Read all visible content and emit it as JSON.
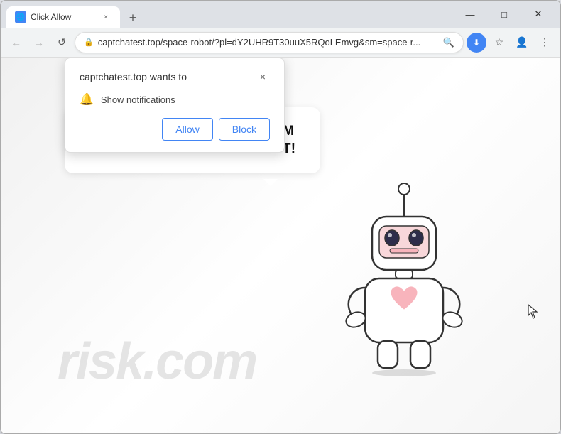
{
  "browser": {
    "title": "Click Allow",
    "tab": {
      "favicon": "🌐",
      "title": "Click Allow",
      "close_label": "×"
    },
    "new_tab_label": "+",
    "window_controls": {
      "minimize": "—",
      "maximize": "□",
      "close": "✕"
    },
    "nav": {
      "back_label": "←",
      "forward_label": "→",
      "reload_label": "↺"
    },
    "url": "captchatest.top/space-robot/?pl=dY2UHR9T30uuX5RQoLEmvg&sm=space-r...",
    "url_full": "captchatest.top/space-robot/?pl=dY2UHR9T30uuX5RQoLEmvg&sm=space-r...",
    "icons": {
      "search": "🔍",
      "star": "☆",
      "profile": "👤",
      "menu": "⋮",
      "lock": "🔒",
      "download": "⬇"
    }
  },
  "popup": {
    "title": "captchatest.top wants to",
    "close_label": "×",
    "notification_label": "Show notifications",
    "allow_label": "Allow",
    "block_label": "Block"
  },
  "page": {
    "message": "CLICK «ALLOW» TO CONFIRM THAT YOU ARE NOT A ROBOT!",
    "watermark": "risk.com"
  }
}
